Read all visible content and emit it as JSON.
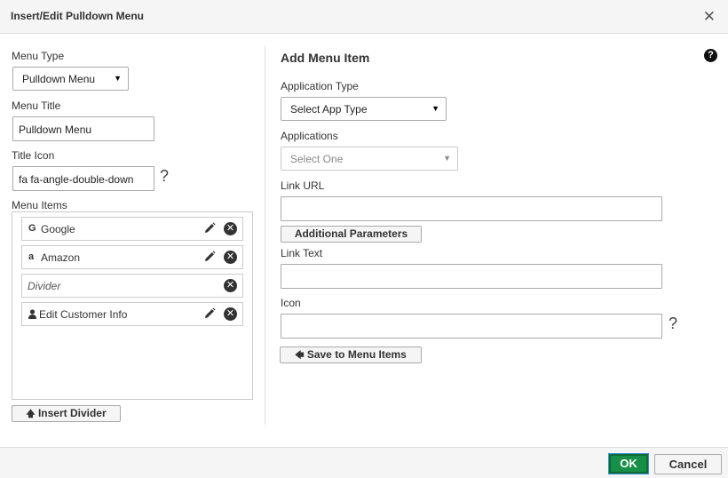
{
  "dialog": {
    "title": "Insert/Edit Pulldown Menu",
    "close_glyph": "✕"
  },
  "left": {
    "menu_type_label": "Menu Type",
    "menu_type_value": "Pulldown Menu",
    "menu_title_label": "Menu Title",
    "menu_title_value": "Pulldown Menu",
    "title_icon_label": "Title Icon",
    "title_icon_value": "fa fa-angle-double-down",
    "title_icon_help": "?",
    "menu_items_label": "Menu Items",
    "menu_items": [
      {
        "label": "Google",
        "icon": "google-icon",
        "glyph": "G",
        "editable": true
      },
      {
        "label": "Amazon",
        "icon": "amazon-icon",
        "glyph": "a",
        "editable": true
      },
      {
        "label": "Divider",
        "icon": "",
        "glyph": "",
        "editable": false
      },
      {
        "label": "Edit Customer Info",
        "icon": "user-icon",
        "glyph": "👤",
        "editable": true
      }
    ],
    "insert_divider_label": "Insert Divider"
  },
  "right": {
    "section_title": "Add Menu Item",
    "help_glyph": "?",
    "app_type_label": "Application Type",
    "app_type_value": "Select App Type",
    "applications_label": "Applications",
    "applications_value": "Select One",
    "link_url_label": "Link URL",
    "link_url_value": "",
    "additional_params_label": "Additional Parameters",
    "link_text_label": "Link Text",
    "link_text_value": "",
    "icon_label": "Icon",
    "icon_value": "",
    "icon_help": "?",
    "save_label": "Save to Menu Items"
  },
  "footer": {
    "ok_label": "OK",
    "cancel_label": "Cancel"
  },
  "colors": {
    "ok_green": "#188f47",
    "title_bg": "#f5f5f5",
    "border": "#aaaaaa"
  }
}
